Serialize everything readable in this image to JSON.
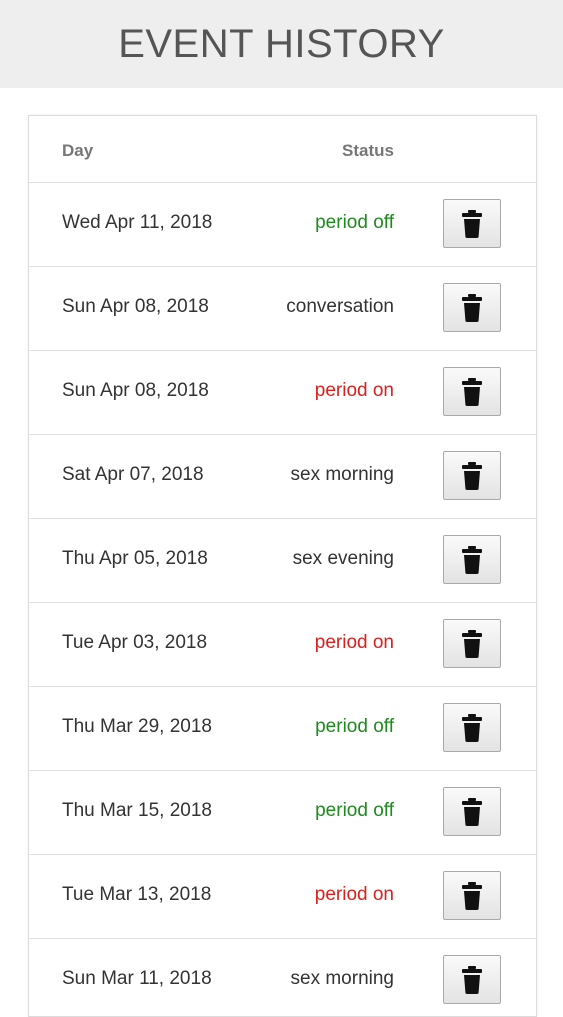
{
  "header": {
    "title": "EVENT HISTORY"
  },
  "table": {
    "columns": {
      "day": "Day",
      "status": "Status"
    },
    "rows": [
      {
        "day": "Wed Apr 11, 2018",
        "status": "period off",
        "status_type": "off"
      },
      {
        "day": "Sun Apr 08, 2018",
        "status": "conversation",
        "status_type": "neutral"
      },
      {
        "day": "Sun Apr 08, 2018",
        "status": "period on",
        "status_type": "on"
      },
      {
        "day": "Sat Apr 07, 2018",
        "status": "sex morning",
        "status_type": "neutral"
      },
      {
        "day": "Thu Apr 05, 2018",
        "status": "sex evening",
        "status_type": "neutral"
      },
      {
        "day": "Tue Apr 03, 2018",
        "status": "period on",
        "status_type": "on"
      },
      {
        "day": "Thu Mar 29, 2018",
        "status": "period off",
        "status_type": "off"
      },
      {
        "day": "Thu Mar 15, 2018",
        "status": "period off",
        "status_type": "off"
      },
      {
        "day": "Tue Mar 13, 2018",
        "status": "period on",
        "status_type": "on"
      },
      {
        "day": "Sun Mar 11, 2018",
        "status": "sex morning",
        "status_type": "neutral"
      }
    ],
    "row_action_icon": "trash-icon"
  },
  "colors": {
    "header_bg": "#eeeeee",
    "title": "#555555",
    "status_on": "#d9211e",
    "status_off": "#1f8a1f",
    "status_neutral": "#333333"
  }
}
